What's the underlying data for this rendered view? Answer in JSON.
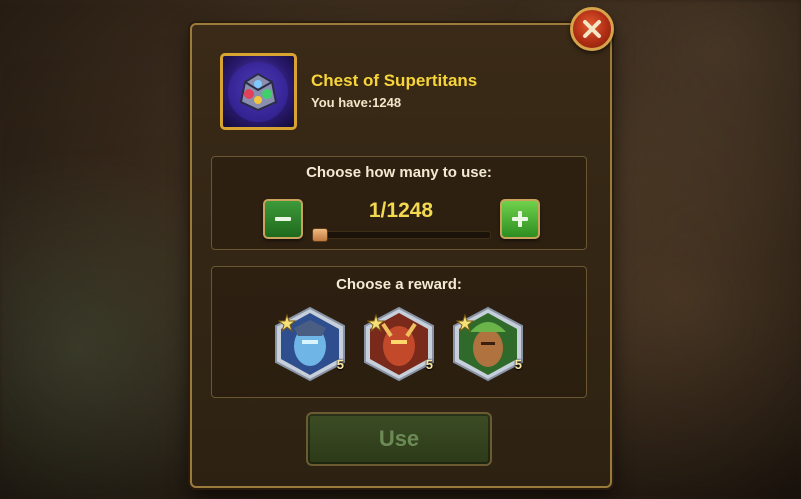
{
  "item": {
    "name": "Chest of Supertitans",
    "owned_text": "You have:1248"
  },
  "quantity": {
    "label": "Choose how many to use:",
    "value_text": "1/1248",
    "current": 1,
    "max": 1248,
    "fraction": 0.0
  },
  "reward": {
    "label": "Choose a reward:",
    "options": [
      {
        "name": "titan-blue",
        "stars": "5"
      },
      {
        "name": "titan-red",
        "stars": "5"
      },
      {
        "name": "titan-green",
        "stars": "5"
      }
    ]
  },
  "actions": {
    "use_label": "Use"
  },
  "colors": {
    "title": "#f7d43a",
    "accent_green": "#2d8e21",
    "border_gold": "#d8a431"
  }
}
